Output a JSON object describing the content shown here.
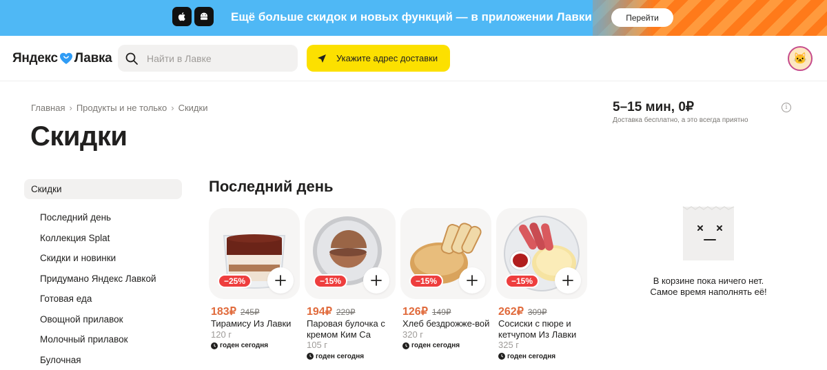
{
  "banner": {
    "text": "Ещё больше скидок и новых функций — в приложении Лавки",
    "button_label": "Перейти",
    "icons": [
      "apple-icon",
      "android-icon"
    ]
  },
  "header": {
    "logo_left": "Яндекс",
    "logo_right": "Лавка",
    "search_placeholder": "Найти в Лавке",
    "address_button_label": "Укажите адрес доставки",
    "avatar_glyph": "🐱"
  },
  "breadcrumb": [
    "Главная",
    "Продукты и не только",
    "Скидки"
  ],
  "page_title": "Скидки",
  "delivery": {
    "time": "5–15 мин, 0₽",
    "subtitle": "Доставка бесплатно, а это всегда приятно",
    "info_glyph": "i"
  },
  "sidebar": {
    "active": "Скидки",
    "items": [
      "Последний день",
      "Коллекция Splat",
      "Скидки и новинки",
      "Придумано Яндекс Лавкой",
      "Готовая еда",
      "Овощной прилавок",
      "Молочный прилавок",
      "Булочная"
    ]
  },
  "section_title": "Последний день",
  "products": [
    {
      "discount": "−25%",
      "price": "183₽",
      "old_price": "245₽",
      "name": "Тирамису Из Лавки",
      "weight": "120 г",
      "shelf_life": "годен сегодня"
    },
    {
      "discount": "−15%",
      "price": "194₽",
      "old_price": "229₽",
      "name": "Паровая булочка с кремом Ким Са",
      "weight": "105 г",
      "shelf_life": "годен сегодня"
    },
    {
      "discount": "−15%",
      "price": "126₽",
      "old_price": "149₽",
      "name": "Хлеб бездрожже-вой",
      "weight": "320 г",
      "shelf_life": "годен сегодня"
    },
    {
      "discount": "−15%",
      "price": "262₽",
      "old_price": "309₽",
      "name": "Сосиски с пюре и кетчупом Из Лавки",
      "weight": "325 г",
      "shelf_life": "годен сегодня"
    }
  ],
  "empty_cart": {
    "line1": "В корзине пока ничего нет.",
    "line2": "Самое время наполнять её!"
  },
  "colors": {
    "banner_blue": "#4fb8f5",
    "accent_yellow": "#fce000",
    "discount_red": "#ee3e3e",
    "price_orange": "#e06a3b"
  }
}
